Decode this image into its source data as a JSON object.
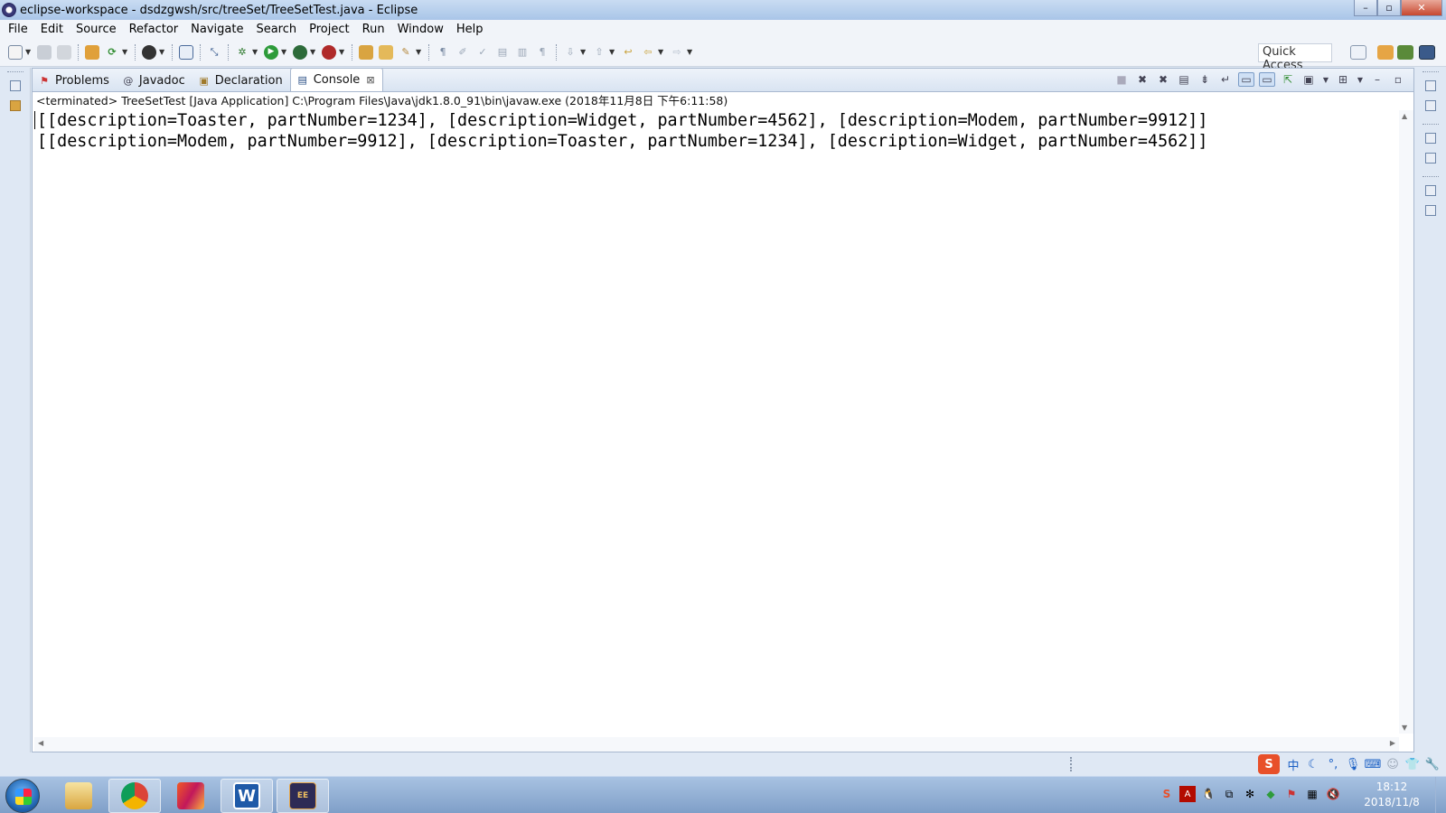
{
  "window": {
    "title": "eclipse-workspace - dsdzgwsh/src/treeSet/TreeSetTest.java - Eclipse",
    "controls": {
      "minimize": "–",
      "maximize": "▫",
      "close": "✕"
    }
  },
  "menubar": {
    "items": [
      "File",
      "Edit",
      "Source",
      "Refactor",
      "Navigate",
      "Search",
      "Project",
      "Run",
      "Window",
      "Help"
    ]
  },
  "toolbar": {
    "quick_access": "Quick Access"
  },
  "view": {
    "tabs": [
      {
        "label": "Problems",
        "icon": "problems-icon",
        "active": false
      },
      {
        "label": "Javadoc",
        "icon": "javadoc-icon",
        "active": false
      },
      {
        "label": "Declaration",
        "icon": "declaration-icon",
        "active": false
      },
      {
        "label": "Console",
        "icon": "console-icon",
        "active": true
      }
    ],
    "close_tab": "⊠"
  },
  "console": {
    "status": "<terminated> TreeSetTest [Java Application] C:\\Program Files\\Java\\jdk1.8.0_91\\bin\\javaw.exe (2018年11月8日 下午6:11:58)",
    "lines": [
      "[[description=Toaster, partNumber=1234], [description=Widget, partNumber=4562], [description=Modem, partNumber=9912]]",
      "[[description=Modem, partNumber=9912], [description=Toaster, partNumber=1234], [description=Widget, partNumber=4562]]"
    ]
  },
  "ime_bar": {
    "logo": "S",
    "mode": "中"
  },
  "taskbar": {
    "apps": [
      "file-explorer",
      "chrome",
      "jetbrains",
      "wps-writer",
      "eclipse-javaee"
    ],
    "active_app": "eclipse-javaee",
    "clock_time": "18:12",
    "clock_date": "2018/11/8"
  },
  "colors": {
    "accent": "#1b5ea8",
    "titlebar": "#b8d0ee",
    "close_button": "#c7472f"
  }
}
